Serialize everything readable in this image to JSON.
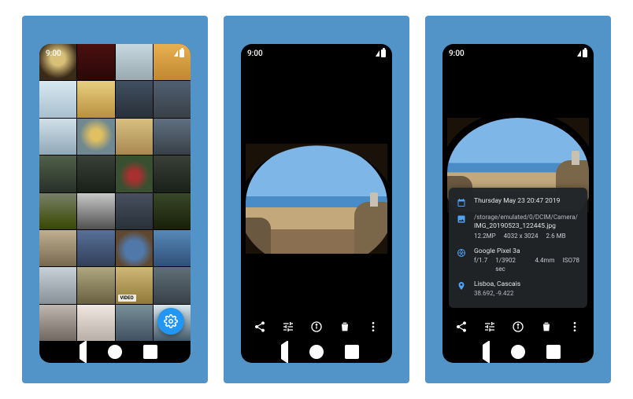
{
  "status": {
    "time": "9:00"
  },
  "gallery": {
    "fab_label": "settings",
    "video_chip": "VIDEO"
  },
  "viewer": {
    "toolbar": {
      "share": "Share",
      "tune": "Edit",
      "info": "Info",
      "delete": "Delete",
      "more": "More"
    }
  },
  "info": {
    "date_label": "Thursday May 23 20:47 2019",
    "path_line": "/storage/emulated/0/DCIM/Camera/",
    "filename": "IMG_20190523_122445.jpg",
    "mp": "12.2MP",
    "dims": "4032 x 3024",
    "size": "2.6 MB",
    "device": "Google Pixel 3a",
    "aperture": "f/1.7",
    "exposure": "1/3902 sec",
    "focal": "4.4mm",
    "iso": "ISO78",
    "place": "Lisboa, Cascais",
    "coords": "38.692, -9.422"
  }
}
